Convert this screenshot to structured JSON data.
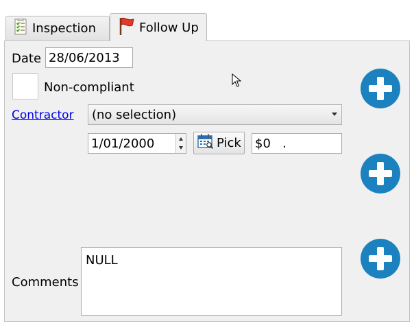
{
  "tabs": [
    {
      "label": "Inspection",
      "icon": "checklist-icon",
      "active": false
    },
    {
      "label": "Follow Up",
      "icon": "red-flag-icon",
      "active": true
    }
  ],
  "form": {
    "date_label": "Date",
    "date_value": "28/06/2013",
    "noncompliant_label": "Non-compliant",
    "noncompliant_checked": false,
    "contractor_link": "Contractor",
    "contractor_selected": "(no selection)",
    "due_date_value": "1/01/2000",
    "pick_label": "Pick",
    "cost_value": "$0   .",
    "comments_label": "Comments",
    "comments_value": "NULL"
  },
  "colors": {
    "accent_blue": "#1b82bf",
    "link_blue": "#0000ee",
    "panel_bg": "#f0f0f0"
  }
}
